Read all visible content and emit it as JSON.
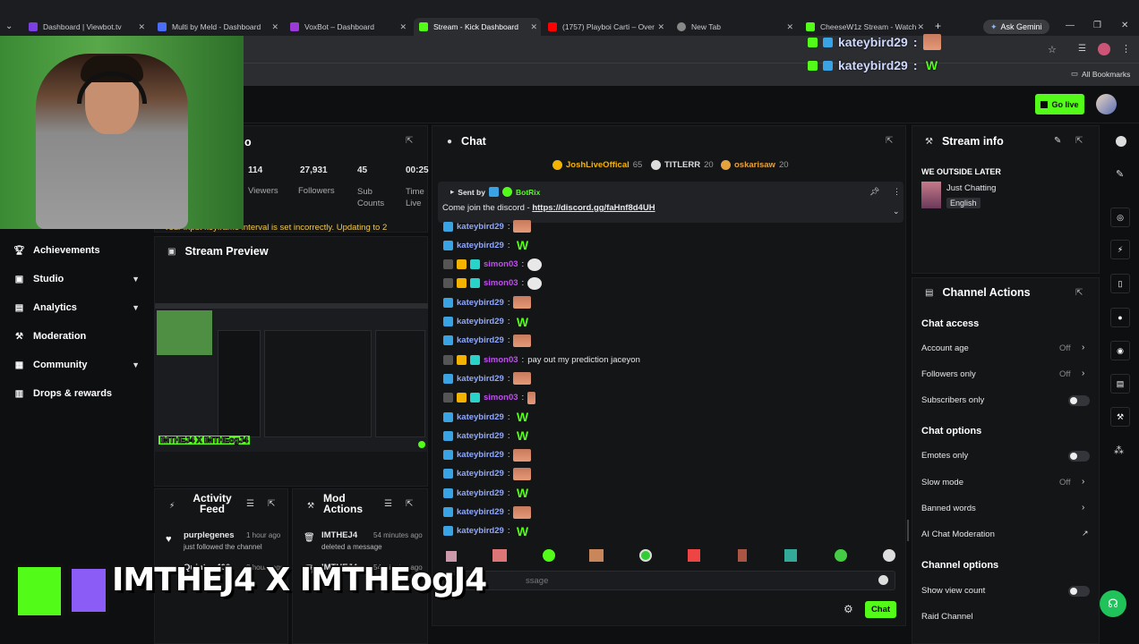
{
  "browser": {
    "tabs": [
      {
        "title": "Dashboard | Viewbot.tv",
        "color": "#7b3fe4"
      },
      {
        "title": "Multi by Meld - Dashboard",
        "color": "#4a6cf7"
      },
      {
        "title": "VoxBot – Dashboard",
        "color": "#9b3ad6"
      },
      {
        "title": "Stream - Kick Dashboard",
        "color": "#53fc18"
      },
      {
        "title": "(1757) Playboi Carti – Over",
        "color": "#ff0000"
      },
      {
        "title": "New Tab",
        "color": "#888888"
      },
      {
        "title": "CheeseW1z Stream - Watch",
        "color": "#53fc18"
      }
    ],
    "ask_gemini": "Ask Gemini",
    "all_bookmarks": "All Bookmarks"
  },
  "overlay_chat": [
    {
      "user": "kateybird29",
      "sep": ":"
    },
    {
      "user": "kateybird29",
      "sep": ":"
    }
  ],
  "header": {
    "go_live": "Go live"
  },
  "stream_stats": {
    "title_fragment": "o",
    "stats": [
      {
        "value": "114",
        "label": "Viewers"
      },
      {
        "value": "27,931",
        "label": "Followers"
      },
      {
        "value": "45",
        "label": "Sub Counts"
      },
      {
        "value": "00:25",
        "label": "Time Live"
      }
    ],
    "warning": "Your input keyframe interval is set incorrectly. Updating to 2"
  },
  "sidebar": {
    "items": [
      {
        "label": "Achievements",
        "icon": "trophy-icon",
        "expandable": false
      },
      {
        "label": "Studio",
        "icon": "studio-icon",
        "expandable": true
      },
      {
        "label": "Analytics",
        "icon": "analytics-icon",
        "expandable": true
      },
      {
        "label": "Moderation",
        "icon": "hammer-icon",
        "expandable": false
      },
      {
        "label": "Community",
        "icon": "community-icon",
        "expandable": true
      },
      {
        "label": "Drops & rewards",
        "icon": "gift-icon",
        "expandable": false
      }
    ]
  },
  "stream_preview": {
    "title": "Stream Preview",
    "watermark": "IMTHEJ4 X IMTHEogJ4"
  },
  "activity_feed": {
    "title": "Activity Feed",
    "items": [
      {
        "user": "purplegenes",
        "time": "1 hour ago",
        "text": "just followed the channel"
      },
      {
        "user": "Quinton400",
        "time": "8 hours ago",
        "text": ""
      }
    ]
  },
  "mod_actions": {
    "title": "Mod Actions",
    "items": [
      {
        "user": "IMTHEJ4",
        "time": "54 minutes ago",
        "text": "deleted a message"
      },
      {
        "user": "IMTHEJ4",
        "time": "54 minutes ago",
        "text": ""
      }
    ]
  },
  "chat": {
    "title": "Chat",
    "top_gifters": [
      {
        "name": "JoshLiveOffical",
        "count": "65",
        "color": "#f5b301"
      },
      {
        "name": "TITLERR",
        "count": "20",
        "color": "#dddddd"
      },
      {
        "name": "oskarisaw",
        "count": "20",
        "color": "#e6a23c"
      }
    ],
    "pinned": {
      "sent_by": "Sent by",
      "author": "BotRix",
      "text": "Come join the discord - ",
      "link": "https://discord.gg/faHnf8d4UH"
    },
    "messages": [
      {
        "user": "kateybird29",
        "color": "#8fa8ff",
        "badges": [
          "bot"
        ],
        "text": "",
        "emote": "face"
      },
      {
        "user": "kateybird29",
        "color": "#8fa8ff",
        "badges": [
          "bot"
        ],
        "text": "",
        "emote": "w"
      },
      {
        "user": "simon03",
        "color": "#c24cf5",
        "badges": [
          "gift",
          "sub",
          "vip"
        ],
        "text": "",
        "emote": "skull"
      },
      {
        "user": "simon03",
        "color": "#c24cf5",
        "badges": [
          "gift",
          "sub",
          "vip"
        ],
        "text": "",
        "emote": "skull"
      },
      {
        "user": "kateybird29",
        "color": "#8fa8ff",
        "badges": [
          "bot"
        ],
        "text": "",
        "emote": "face"
      },
      {
        "user": "kateybird29",
        "color": "#8fa8ff",
        "badges": [
          "bot"
        ],
        "text": "",
        "emote": "w"
      },
      {
        "user": "kateybird29",
        "color": "#8fa8ff",
        "badges": [
          "bot"
        ],
        "text": "",
        "emote": "face"
      },
      {
        "user": "simon03",
        "color": "#c24cf5",
        "badges": [
          "gift",
          "sub",
          "vip"
        ],
        "text": "pay out my prediction jaceyon",
        "emote": ""
      },
      {
        "user": "kateybird29",
        "color": "#8fa8ff",
        "badges": [
          "bot"
        ],
        "text": "",
        "emote": "face"
      },
      {
        "user": "simon03",
        "color": "#c24cf5",
        "badges": [
          "gift",
          "sub",
          "vip"
        ],
        "text": "",
        "emote": "small"
      },
      {
        "user": "kateybird29",
        "color": "#8fa8ff",
        "badges": [
          "bot"
        ],
        "text": "",
        "emote": "w"
      },
      {
        "user": "kateybird29",
        "color": "#8fa8ff",
        "badges": [
          "bot"
        ],
        "text": "",
        "emote": "w"
      },
      {
        "user": "kateybird29",
        "color": "#8fa8ff",
        "badges": [
          "bot"
        ],
        "text": "",
        "emote": "face"
      },
      {
        "user": "kateybird29",
        "color": "#8fa8ff",
        "badges": [
          "bot"
        ],
        "text": "",
        "emote": "face"
      },
      {
        "user": "kateybird29",
        "color": "#8fa8ff",
        "badges": [
          "bot"
        ],
        "text": "",
        "emote": "w"
      },
      {
        "user": "kateybird29",
        "color": "#8fa8ff",
        "badges": [
          "bot"
        ],
        "text": "",
        "emote": "face"
      },
      {
        "user": "kateybird29",
        "color": "#8fa8ff",
        "badges": [
          "bot"
        ],
        "text": "",
        "emote": "w"
      }
    ],
    "input_placeholder": "ssage",
    "send_label": "Chat"
  },
  "stream_info": {
    "title": "Stream info",
    "stream_title": "WE OUTSIDE LATER",
    "category": "Just Chatting",
    "language": "English"
  },
  "channel_actions": {
    "title": "Channel Actions",
    "chat_access": "Chat access",
    "account_age": {
      "label": "Account age",
      "value": "Off"
    },
    "followers_only": {
      "label": "Followers only",
      "value": "Off"
    },
    "subscribers_only": {
      "label": "Subscribers only"
    },
    "chat_options": "Chat options",
    "emotes_only": {
      "label": "Emotes only"
    },
    "slow_mode": {
      "label": "Slow mode",
      "value": "Off"
    },
    "banned_words": {
      "label": "Banned words"
    },
    "ai_moderation": {
      "label": "AI Chat Moderation"
    },
    "channel_options": "Channel options",
    "show_view_count": {
      "label": "Show view count"
    },
    "raid_channel": {
      "label": "Raid Channel"
    }
  },
  "overlay_logo": {
    "text": "IMTHEJ4 X IMTHEogJ4",
    "brand": "#53fc18"
  }
}
